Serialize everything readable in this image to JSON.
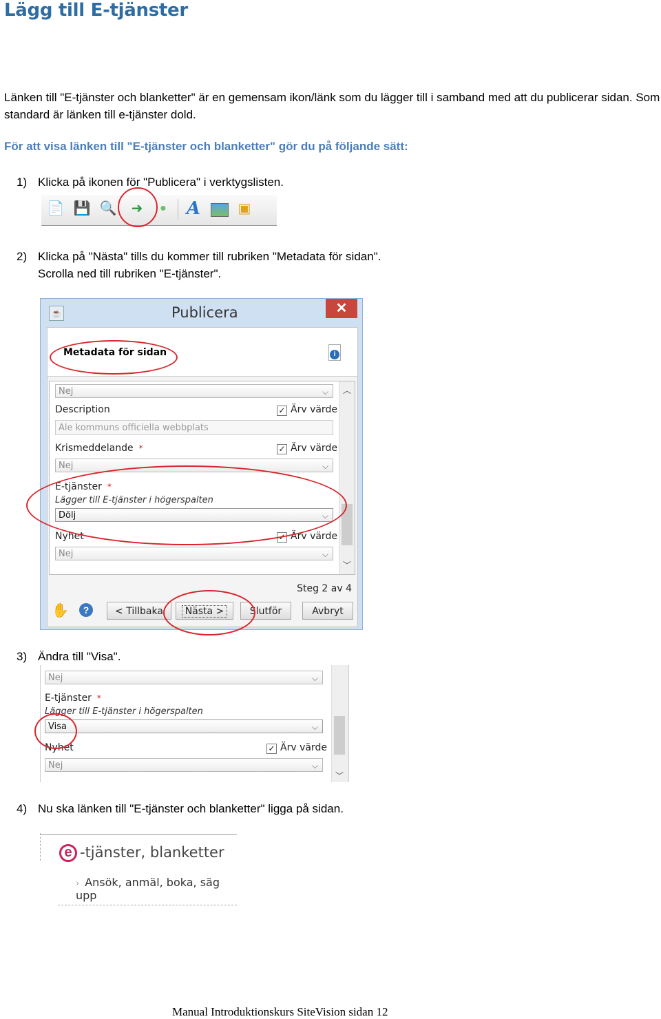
{
  "page": {
    "title": "Lägg till E-tjänster",
    "intro": "Länken till \"E-tjänster och blanketter\" är en gemensam ikon/länk som du lägger till i samband med att du publicerar sidan. Som standard är länken till e-tjänster dold.",
    "subheading": "För att visa länken till \"E-tjänster och blanketter\" gör du på följande sätt:",
    "footer": "Manual Introduktionskurs SiteVision sidan 12"
  },
  "steps": [
    {
      "num": "1)",
      "text": "Klicka på ikonen för \"Publicera\" i verktygslisten."
    },
    {
      "num": "2)",
      "text": "Klicka på \"Nästa\" tills du kommer till rubriken \"Metadata för sidan\".",
      "text2": "Scrolla ned till rubriken \"E-tjänster\"."
    },
    {
      "num": "3)",
      "text": "Ändra till \"Visa\"."
    },
    {
      "num": "4)",
      "text": "Nu ska länken till \"E-tjänster och blanketter\" ligga på sidan."
    }
  ],
  "toolbar": {
    "icons": [
      "new-page-icon",
      "save-icon",
      "search-icon",
      "publish-icon",
      "status-dot-icon",
      "text-format-icon",
      "image-icon",
      "modules-icon"
    ]
  },
  "dialog": {
    "title": "Publicera",
    "close": "✕",
    "section_title": "Metadata för sidan",
    "fields": {
      "top_select": "Nej",
      "description_label": "Description",
      "description_value": "Ale kommuns officiella webbplats",
      "krismeddelande_label": "Krismeddelande",
      "krismeddelande_value": "Nej",
      "etjanster_label": "E-tjänster",
      "etjanster_note": "Lägger till E-tjänster i högerspalten",
      "etjanster_value": "Dölj",
      "nyhet_label": "Nyhet",
      "nyhet_value": "Nej",
      "inherit_label": "Ärv värde",
      "required_mark": "*"
    },
    "step_indicator": "Steg 2 av 4",
    "buttons": {
      "back": "< Tillbaka",
      "next": "Nästa >",
      "finish": "Slutför",
      "cancel": "Avbryt"
    },
    "help": "?"
  },
  "snippet3": {
    "top_select": "Nej",
    "etjanster_label": "E-tjänster",
    "etjanster_note": "Lägger till E-tjänster i högerspalten",
    "etjanster_value": "Visa",
    "nyhet_label": "Nyhet",
    "inherit_label": "Ärv värde",
    "nyhet_value": "Nej",
    "required_mark": "*"
  },
  "result": {
    "logo_letter": "e",
    "title": "-tjänster, blanketter",
    "link": "Ansök, anmäl, boka, säg upp",
    "chevron": "›"
  },
  "colors": {
    "heading": "#2e6da4",
    "subheading": "#4a7ebb",
    "highlight_ring": "#d9262c",
    "dialog_close": "#c9463d",
    "e_logo": "#c8245b"
  }
}
